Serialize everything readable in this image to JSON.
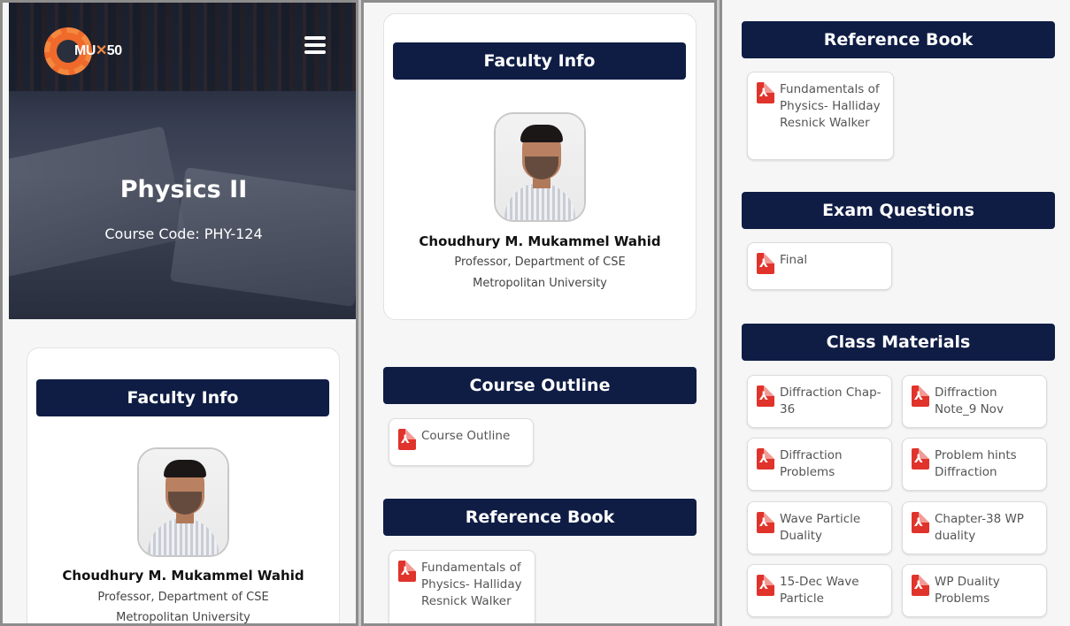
{
  "logo": {
    "text_mu": "MU",
    "text_rest": "50"
  },
  "course": {
    "title": "Physics II",
    "code": "Course Code: PHY-124"
  },
  "faculty": {
    "header": "Faculty Info",
    "name": "Choudhury M. Mukammel Wahid",
    "designation": "Professor, Department of CSE",
    "university": "Metropolitan University"
  },
  "sections": {
    "course_outline": {
      "header": "Course Outline",
      "files": [
        "Course Outline"
      ]
    },
    "reference_book": {
      "header": "Reference Book",
      "files": [
        "Fundamentals of Physics- Halliday Resnick Walker"
      ]
    },
    "exam_questions": {
      "header": "Exam Questions",
      "files": [
        "Final"
      ]
    },
    "class_materials": {
      "header": "Class Materials",
      "files": [
        "Diffraction Chap-36",
        "Diffraction Note_9 Nov",
        "Diffraction Problems",
        "Problem hints Diffraction",
        "Wave Particle Duality",
        "Chapter-38 WP duality",
        "15-Dec Wave Particle",
        "WP Duality Problems"
      ]
    }
  },
  "colors": {
    "header_bg": "#0f1d45",
    "pdf_red": "#e0332b",
    "logo_orange": "#f06a2c"
  },
  "icons": {
    "pdf": "pdf-file-icon",
    "menu": "hamburger-menu-icon",
    "logo": "gear-logo-icon"
  }
}
